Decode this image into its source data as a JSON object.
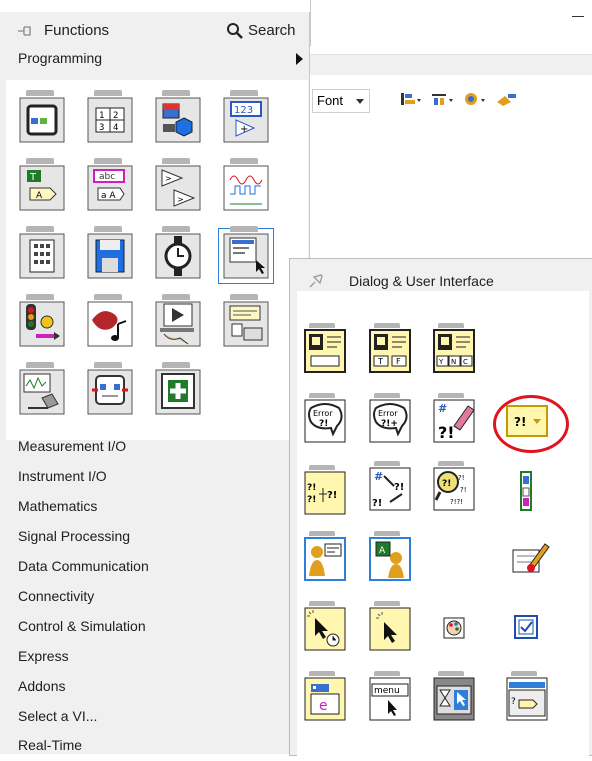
{
  "background_window": {
    "minimize_glyph": "–",
    "toolbar": {
      "font_label": "Font",
      "tools": [
        "align-objects-icon",
        "distribute-objects-icon",
        "reorder-icon",
        "cleanup-icon"
      ]
    }
  },
  "functions_palette": {
    "title": "Functions",
    "search_label": "Search",
    "programming_label": "Programming",
    "icon_names": [
      "structures-icon",
      "array-icon",
      "cluster-class-variant-icon",
      "numeric-icon",
      "boolean-icon",
      "string-icon",
      "comparison-icon",
      "timing-waveform-icon",
      "dialog-ui-icon",
      "file-io-icon",
      "time-dialog-icon",
      "dialog-user-interface-icon",
      "sync-icon",
      "graphics-sound-icon",
      "application-control-icon",
      "report-generation-icon",
      "waveform-icon",
      "memory-icon",
      "user-icon"
    ],
    "categories": [
      "Measurement I/O",
      "Instrument I/O",
      "Mathematics",
      "Signal Processing",
      "Data Communication",
      "Connectivity",
      "Control & Simulation",
      "Express",
      "Addons",
      "Select a VI...",
      "Real-Time"
    ]
  },
  "submenu": {
    "title": "Dialog & User Interface",
    "icon_names": [
      "one-button-dialog-icon",
      "two-button-dialog-icon",
      "three-button-dialog-icon",
      "simple-error-handler-icon",
      "general-error-handler-icon",
      "clear-errors-icon",
      "error-ring-icon",
      "merge-errors-icon",
      "error-cluster-from-code-icon",
      "find-first-error-icon",
      "error-ring-vertical-icon",
      "prompt-user-icon",
      "display-message-icon",
      "user-defined-icon",
      "cursor-icon",
      "set-busy-icon",
      "colors-icon",
      "checkbox-icon",
      "events-icon",
      "menu-icon",
      "cursor-busy-icon",
      "dialog-box-icon"
    ],
    "highlighted_item": "error-ring-icon"
  },
  "colors": {
    "palette_bg": "#f0f0f0",
    "icon_bg": "#ffffff",
    "selection_outline": "#2f7fd8",
    "highlight_circle": "#e0141e",
    "dialog_icon_fill": "#fff6b0"
  }
}
